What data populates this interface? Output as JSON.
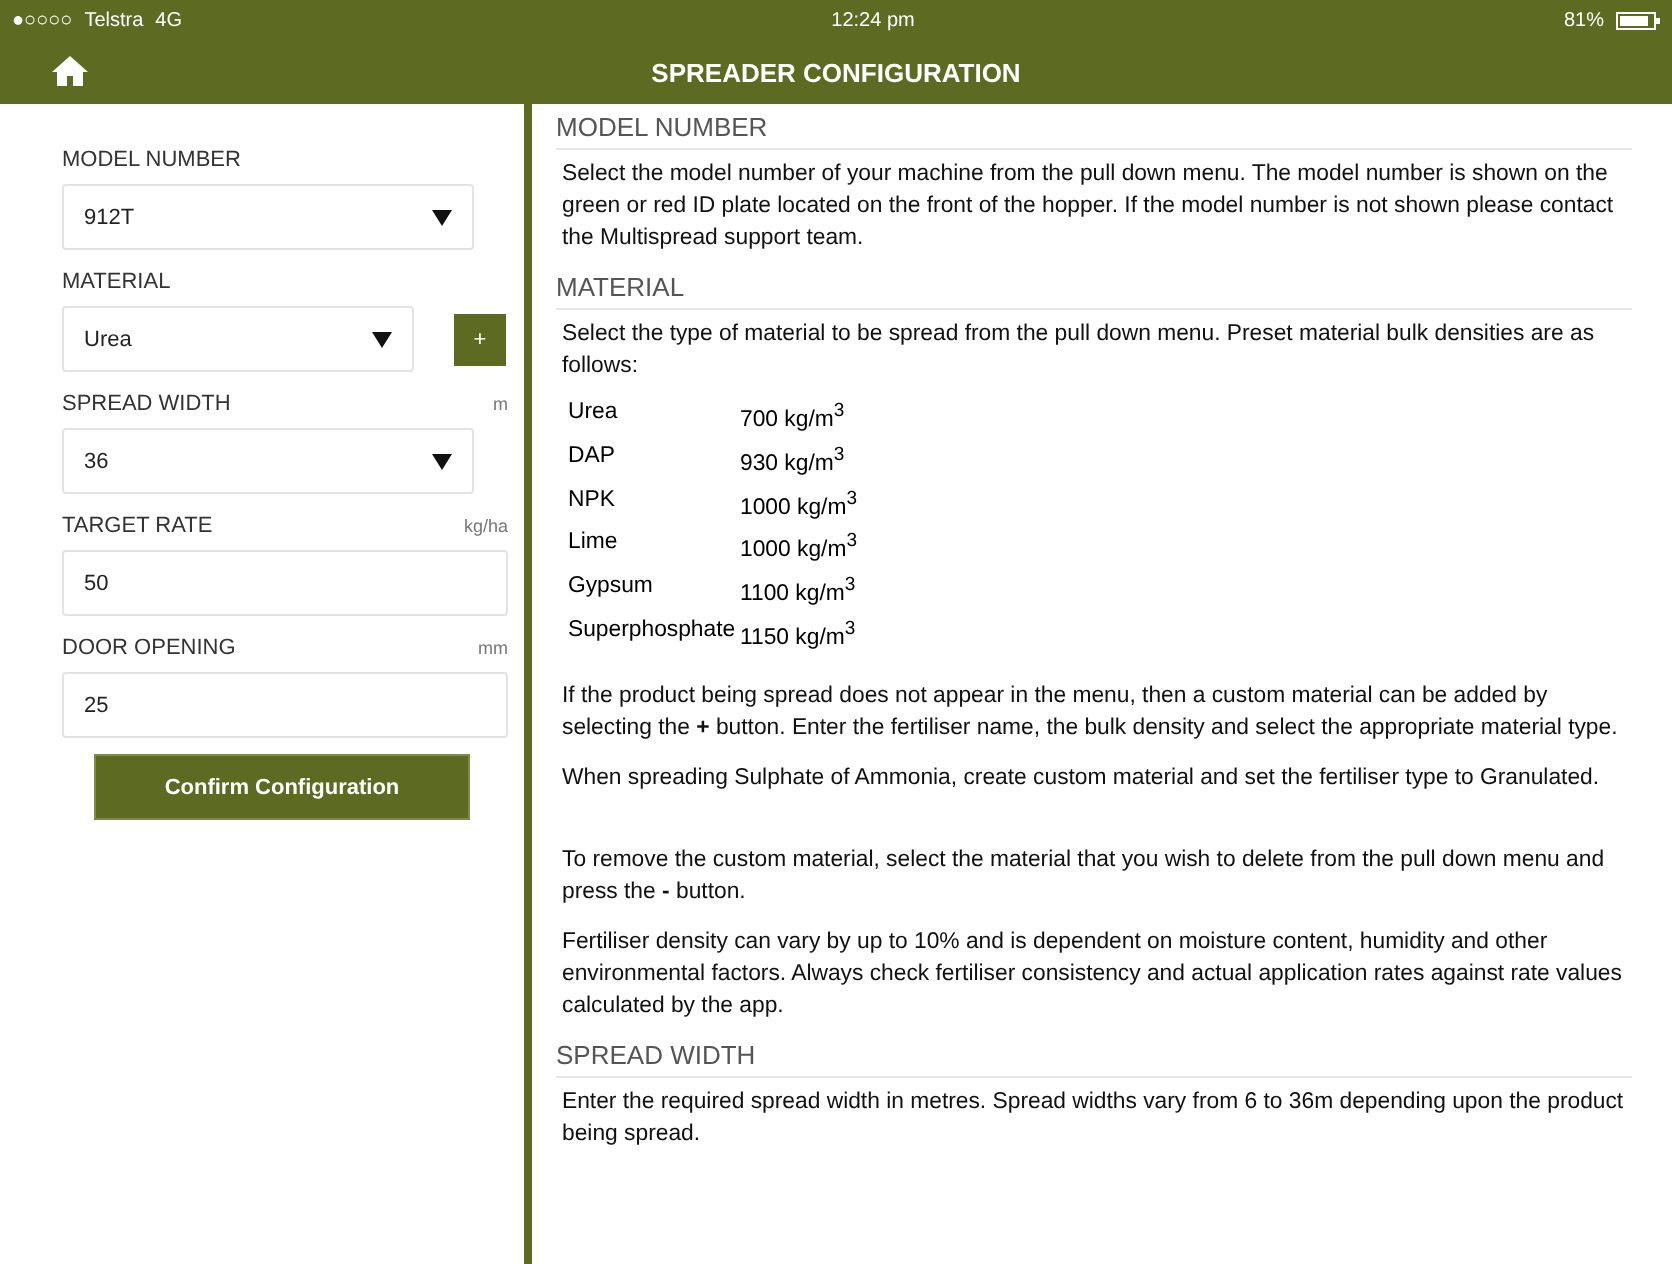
{
  "status_bar": {
    "signal": "●○○○○",
    "carrier": "Telstra",
    "network": "4G",
    "time": "12:24 pm",
    "battery": "81%"
  },
  "nav_bar": {
    "title": "SPREADER CONFIGURATION"
  },
  "form": {
    "fields": [
      {
        "label": "MODEL NUMBER",
        "kind": "select",
        "value": "912T"
      },
      {
        "label": "MATERIAL",
        "kind": "select",
        "value": "Urea",
        "action": "+"
      },
      {
        "label": "SPREAD WIDTH",
        "unit": "m",
        "kind": "select",
        "value": "36"
      },
      {
        "label": "TARGET RATE",
        "unit": "kg/ha",
        "kind": "input",
        "value": "50"
      },
      {
        "label": "DOOR OPENING",
        "unit": "mm",
        "kind": "input",
        "value": "25"
      }
    ],
    "confirm_button": "Confirm Configuration"
  },
  "help": {
    "sections": [
      {
        "heading": "MODEL NUMBER",
        "blocks": [
          {
            "kind": "paragraph",
            "text": "Select the model number of your machine from the pull down menu. The model number is shown on the green or red ID plate located on the front of the hopper. If the model number is not shown please contact the Multispread support team."
          }
        ]
      },
      {
        "heading": "MATERIAL",
        "blocks": [
          {
            "kind": "paragraph",
            "text": "Select the type of material to be spread from the pull down menu. Preset material bulk densities are as follows:"
          },
          {
            "kind": "table",
            "rows": [
              {
                "material": "Urea",
                "density": "700 kg/m$^{3}$"
              },
              {
                "material": "DAP",
                "density": "930 kg/m$^{3}$"
              },
              {
                "material": "NPK",
                "density": "1000 kg/m$^{3}$"
              },
              {
                "material": "Lime",
                "density": "1000 kg/m$^{3}$"
              },
              {
                "material": "Gypsum",
                "density": "1100 kg/m$^{3}$"
              },
              {
                "material": "Superphosphate",
                "density": "1150 kg/m$^{3}$"
              }
            ]
          },
          {
            "kind": "paragraph",
            "text": "If the product being spread does not appear in the menu, then a custom material can be added by selecting the **+** button. Enter the fertiliser name, the bulk density and select the appropriate material type."
          },
          {
            "kind": "paragraph",
            "text": "When spreading Sulphate of Ammonia, create custom material and set the fertiliser type to Granulated."
          },
          {
            "kind": "spacer"
          },
          {
            "kind": "paragraph",
            "text": "To remove the custom material, select the material that you wish to delete from the pull down menu and press the **-** button."
          },
          {
            "kind": "paragraph",
            "text": "Fertiliser density can vary by up to 10% and is dependent on moisture content, humidity and other environmental factors. Always check fertiliser consistency and actual application rates against rate values calculated by the app."
          }
        ]
      },
      {
        "heading": "SPREAD WIDTH",
        "blocks": [
          {
            "kind": "paragraph",
            "text": "Enter the required spread width in metres. Spread widths vary from 6 to 36m depending upon the product being spread."
          }
        ]
      }
    ]
  }
}
